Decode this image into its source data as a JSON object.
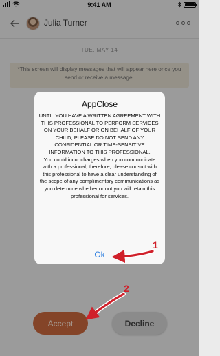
{
  "status_bar": {
    "time": "9:41 AM"
  },
  "header": {
    "contact_name": "Julia Turner"
  },
  "chat": {
    "date_label": "TUE, MAY 14",
    "placeholder": "*This screen will display messages that will appear here once you send or receive a message."
  },
  "actions": {
    "accept_label": "Accept",
    "decline_label": "Decline"
  },
  "dialog": {
    "title": "AppClose",
    "message_lines": [
      "UNTIL YOU HAVE A WRITTEN AGREEMENT WITH THIS PROFESSIONAL TO PERFORM SERVICES ON YOUR BEHALF OR ON BEHALF OF YOUR CHILD, PLEASE DO NOT SEND ANY CONFIDENTIAL OR TIME-SENSITIVE INFORMATION TO THIS PROFESSIONAL.",
      "You could incur charges when you communicate with a professional; therefore, please consult with this professional to have a clear understanding of the scope of any complimentary communications as you determine whether or not you will retain this professional for services."
    ],
    "ok_label": "Ok"
  },
  "annotations": {
    "step_1": "1",
    "step_2": "2"
  },
  "colors": {
    "accent": "#c9683e",
    "link_blue": "#2f7fe0",
    "annotation_red": "#d0202a"
  }
}
